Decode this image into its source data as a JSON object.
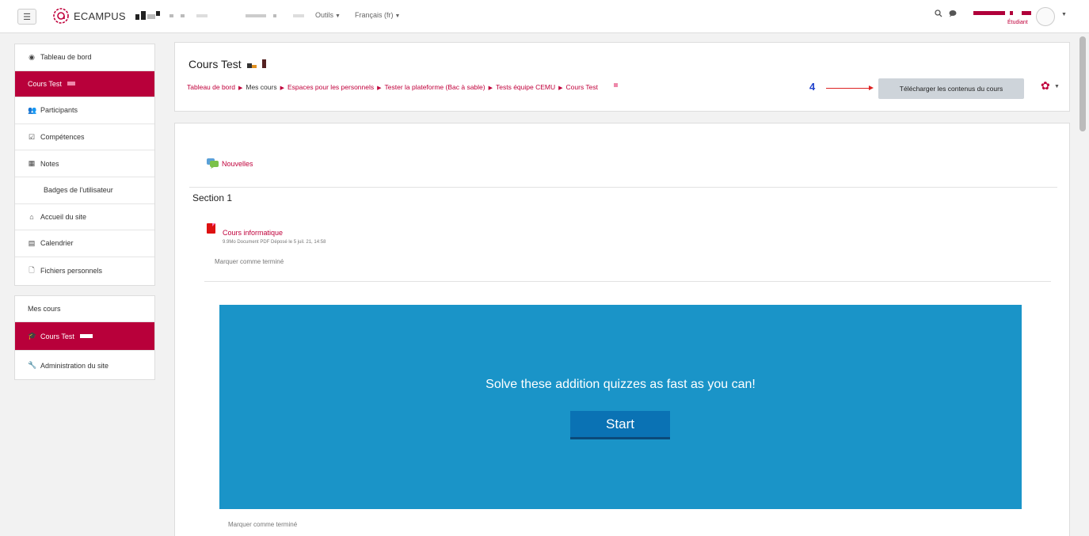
{
  "navbar": {
    "brand": "ECAMPUS",
    "menus": [
      {
        "label": "Outils"
      },
      {
        "label": "Français (fr)"
      }
    ],
    "user_role": "Étudiant",
    "icons": [
      "menu-icon",
      "search-icon",
      "chat-icon",
      "user-avatar",
      "caret-down-icon"
    ]
  },
  "sidebar": {
    "nav": [
      {
        "label": "Tableau de bord",
        "icon": "dashboard-icon"
      },
      {
        "label": "Cours Test",
        "icon": ""
      },
      {
        "label": "Participants",
        "icon": "users-icon"
      },
      {
        "label": "Compétences",
        "icon": "checkbox-icon"
      },
      {
        "label": "Notes",
        "icon": "table-icon"
      },
      {
        "label": "Badges de l'utilisateur",
        "icon": ""
      },
      {
        "label": "Accueil du site",
        "icon": "home-icon"
      },
      {
        "label": "Calendrier",
        "icon": "calendar-icon"
      },
      {
        "label": "Fichiers personnels",
        "icon": "file-icon"
      }
    ],
    "courses_heading": "Mes cours",
    "courses": [
      {
        "label": "Cours Test",
        "icon": "graduation-cap-icon"
      },
      {
        "label": "Administration du site",
        "icon": "wrench-icon"
      }
    ]
  },
  "header": {
    "title": "Cours Test",
    "breadcrumb": [
      "Tableau de bord",
      "Mes cours",
      "Espaces pour les personnels",
      "Tester la plateforme (Bac à sable)",
      "Tests équipe CEMU",
      "Cours Test"
    ],
    "step_number": "4",
    "download_label": "Télécharger les contenus du cours"
  },
  "content": {
    "news_label": "Nouvelles",
    "section_title": "Section 1",
    "resource_name": "Cours informatique",
    "resource_meta": "9.9Mo Document PDF Déposé le 5 juil. 21, 14:58",
    "mark_done_1": "Marquer comme terminé",
    "mark_done_2": "Marquer comme terminé",
    "game_prompt": "Solve these addition quizzes as fast as you can!",
    "start_label": "Start"
  },
  "colors": {
    "brand": "#b8003a",
    "link": "#c0003b",
    "game_bg": "#1a94c8",
    "start_btn": "#0a72b4",
    "step_number": "#2244cc"
  }
}
